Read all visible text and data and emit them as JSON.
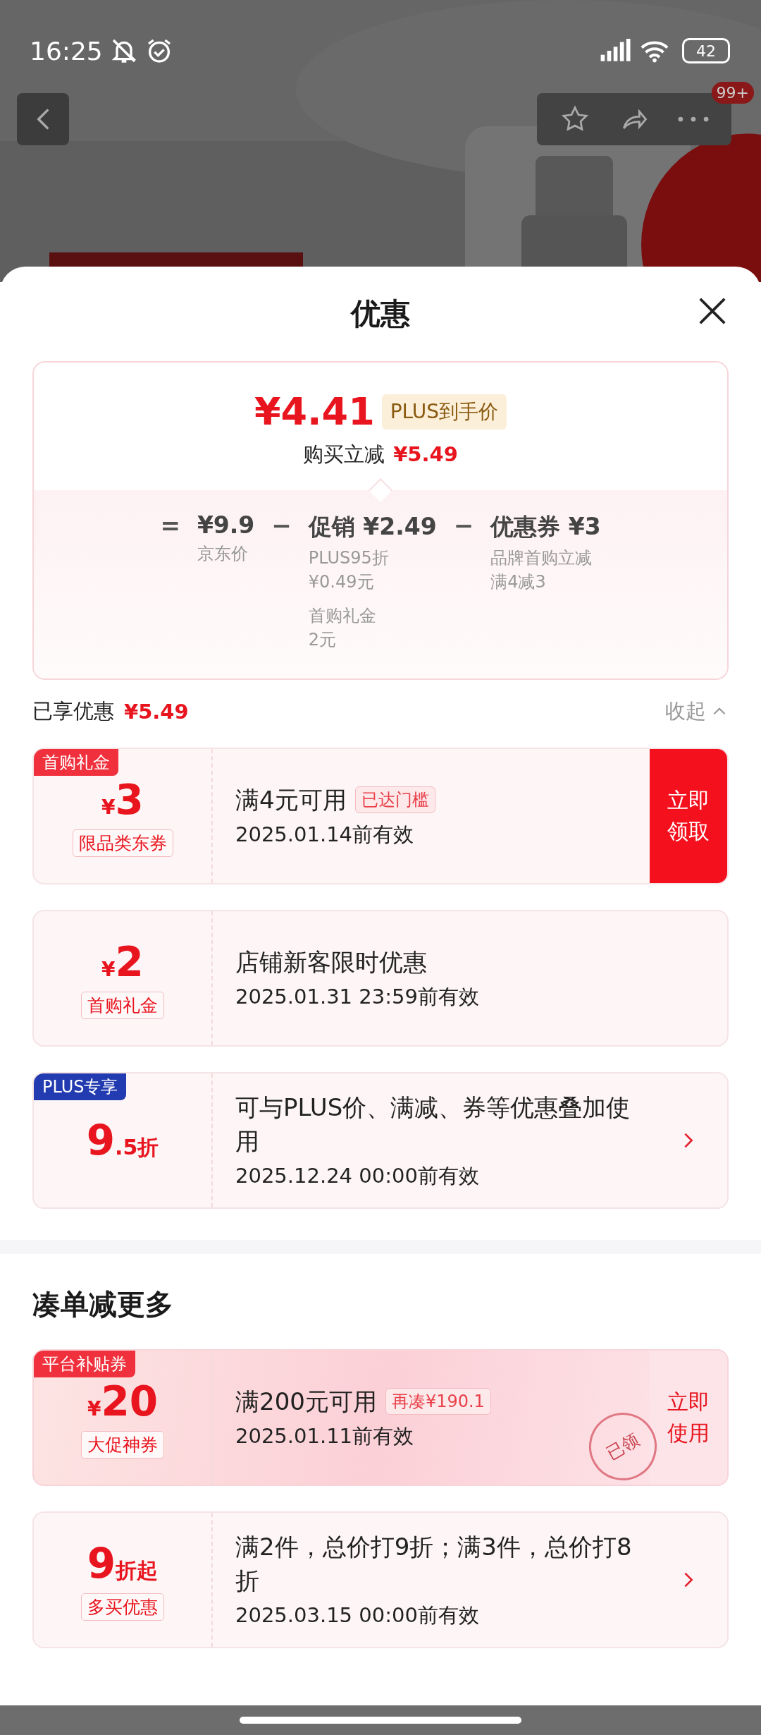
{
  "status_bar": {
    "time": "16:25",
    "battery": "42"
  },
  "top_bar": {
    "badge": "99+"
  },
  "sheet": {
    "title": "优惠"
  },
  "price_card": {
    "price": "¥4.41",
    "price_tag": "PLUS到手价",
    "saving_label": "购买立减",
    "saving": "¥5.49",
    "breakdown": [
      {
        "op": "=",
        "amount": "¥9.9",
        "notes": [
          [
            "京东价"
          ]
        ]
      },
      {
        "op": "−",
        "amount": "促销 ¥2.49",
        "notes": [
          [
            "PLUS95折",
            "¥0.49元"
          ],
          [
            "首购礼金",
            "2元"
          ]
        ]
      },
      {
        "op": "−",
        "amount": "优惠券 ¥3",
        "notes": [
          [
            "品牌首购立减",
            "满4减3"
          ]
        ]
      }
    ]
  },
  "summary": {
    "label": "已享优惠",
    "amount": "¥5.49",
    "toggle": "收起",
    "expanded": true
  },
  "coupons": [
    {
      "kind": "plain",
      "tag": {
        "text": "首购礼金",
        "kind": "red"
      },
      "prefix": "¥",
      "main": "3",
      "label": "限品类东券",
      "title": "满4元可用",
      "badge": "已达门槛",
      "date": "2025.01.14前有效",
      "action": {
        "kind": "button",
        "text": "立即领取"
      }
    },
    {
      "kind": "plain",
      "prefix": "¥",
      "main": "2",
      "label": "首购礼金",
      "title": "店铺新客限时优惠",
      "date": "2025.01.31 23:59前有效",
      "action": {
        "kind": "none"
      }
    },
    {
      "kind": "plain",
      "tag": {
        "text": "PLUS专享",
        "kind": "plus"
      },
      "main": "9",
      "suffix": ".5折",
      "title": "可与PLUS价、满减、券等优惠叠加使用",
      "date": "2025.12.24 00:00前有效",
      "action": {
        "kind": "arrow"
      }
    }
  ],
  "more_section": {
    "title": "凑单减更多",
    "coupons": [
      {
        "kind": "promo",
        "tag": {
          "text": "平台补贴券",
          "kind": "red"
        },
        "prefix": "¥",
        "main": "20",
        "label": "大促神券",
        "title": "满200元可用",
        "badge": "再凑¥190.1",
        "date": "2025.01.11前有效",
        "stamp": "已领",
        "action": {
          "kind": "light",
          "text": "立即使用"
        }
      },
      {
        "kind": "plain",
        "main": "9",
        "suffix": "折起",
        "label": "多买优惠",
        "title": "满2件，总价打9折；满3件，总价打8折",
        "date": "2025.03.15 00:00前有效",
        "action": {
          "kind": "arrow"
        }
      }
    ]
  }
}
